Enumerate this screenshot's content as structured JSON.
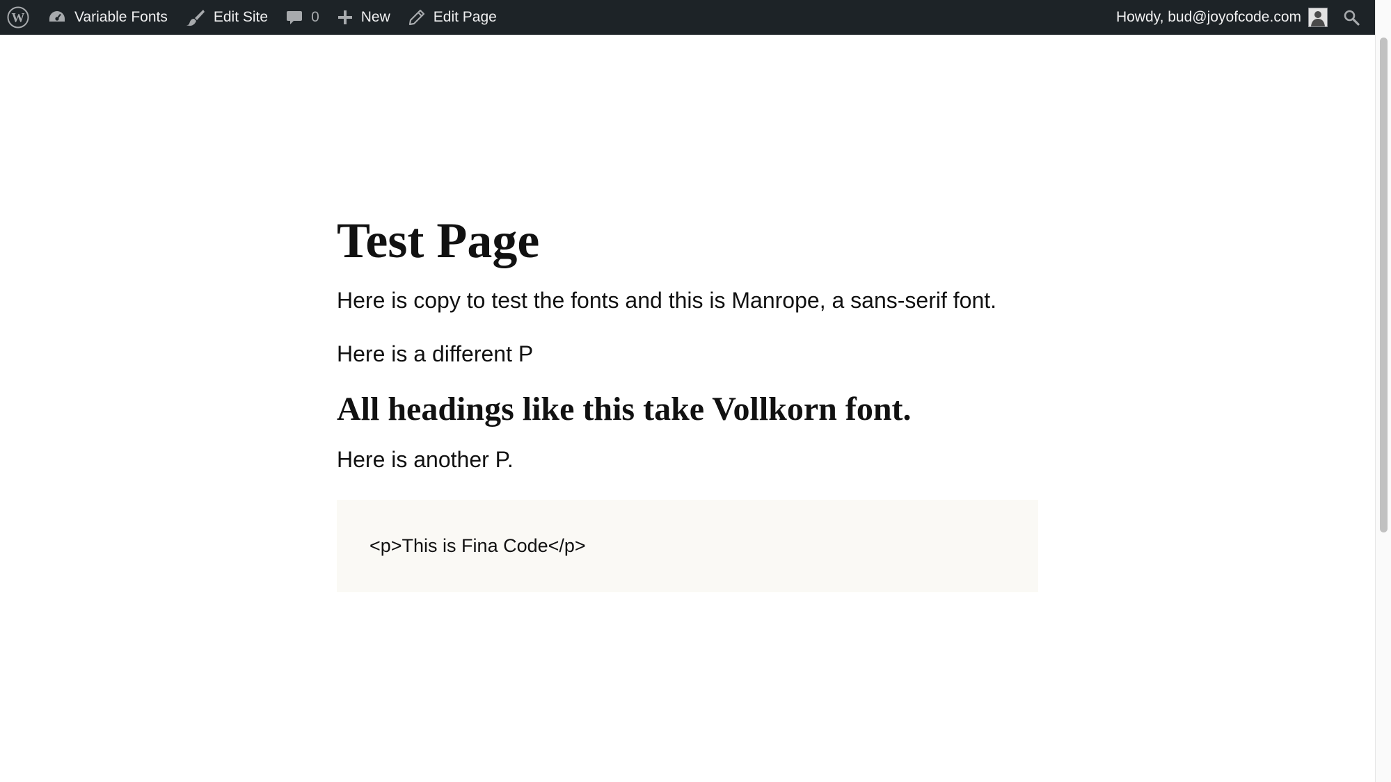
{
  "admin_bar": {
    "site_name": "Variable Fonts",
    "edit_site": "Edit Site",
    "comments_count": "0",
    "new_label": "New",
    "edit_page": "Edit Page",
    "howdy": "Howdy, bud@joyofcode.com",
    "icons": [
      "wordpress-logo-icon",
      "dashboard-icon",
      "brush-icon",
      "comment-icon",
      "plus-icon",
      "pencil-icon",
      "avatar",
      "search-icon"
    ]
  },
  "page": {
    "title": "Test Page",
    "paragraph_1": "Here is copy to test the fonts and this is Manrope, a sans-serif font.",
    "paragraph_2": "Here is a different P",
    "heading_2": "All headings like this take Vollkorn font.",
    "paragraph_3": "Here is another P.",
    "code": "<p>This is Fina Code</p>"
  },
  "colors": {
    "admin_bar_bg": "#1d2327",
    "admin_bar_text": "#f0f0f1",
    "code_bg": "#faf9f5",
    "text": "#111111"
  }
}
